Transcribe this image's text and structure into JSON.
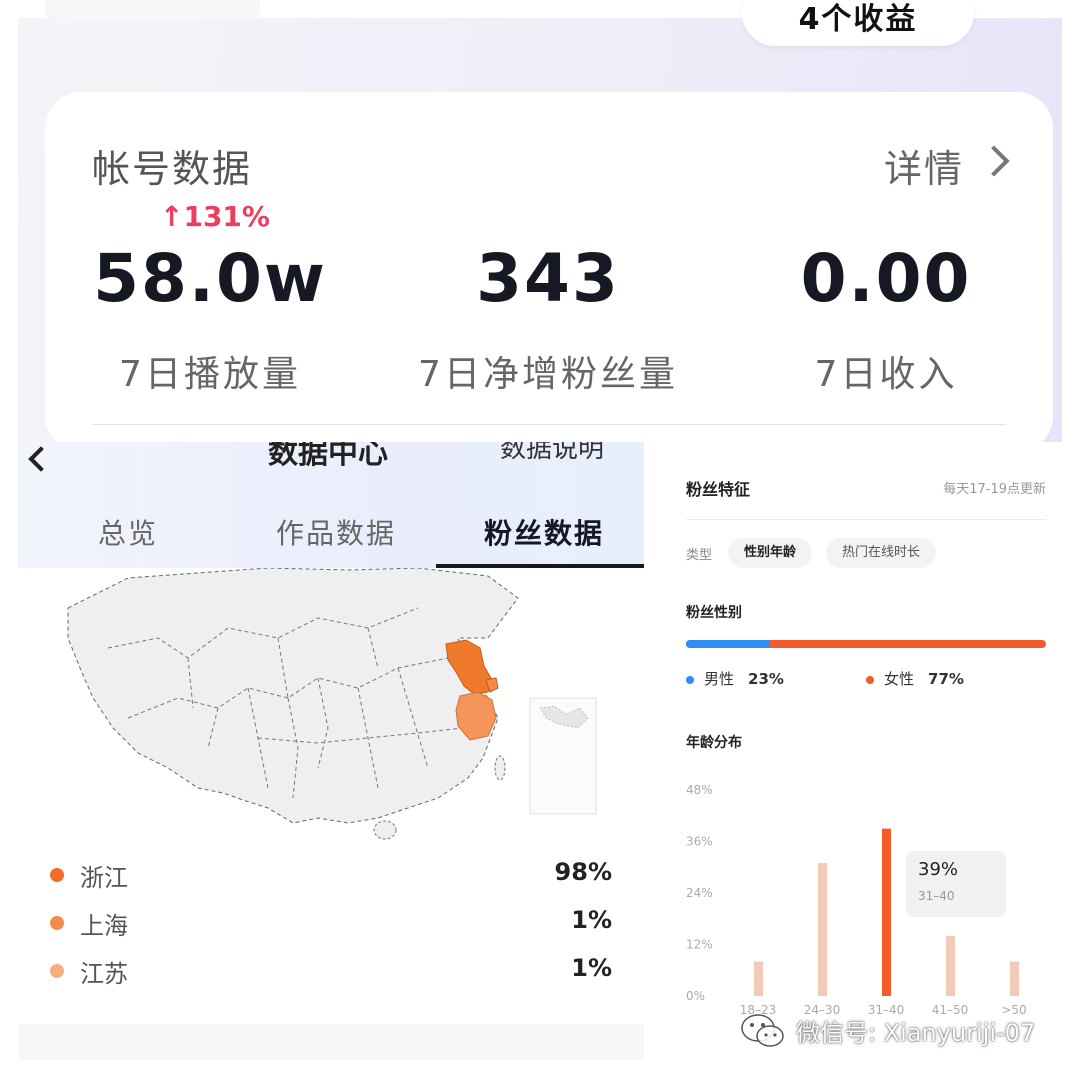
{
  "top": {
    "earnings_pill": "4个收益",
    "card_title": "帐号数据",
    "detail_label": "详情",
    "growth": "↑131%",
    "metrics": [
      {
        "value": "58.0w",
        "label": "7日播放量"
      },
      {
        "value": "343",
        "label": "7日净增粉丝量"
      },
      {
        "value": "0.00",
        "label": "7日收入"
      }
    ]
  },
  "data_center": {
    "header_cut_title": "数据中心",
    "header_cut_right": "数据说明",
    "tabs": [
      {
        "label": "总览",
        "active": false
      },
      {
        "label": "作品数据",
        "active": false
      },
      {
        "label": "粉丝数据",
        "active": true
      }
    ],
    "regions": [
      {
        "name": "浙江",
        "percent": "98%",
        "color": "#f26c2a"
      },
      {
        "name": "上海",
        "percent": "1%",
        "color": "#f58a4a"
      },
      {
        "name": "江苏",
        "percent": "1%",
        "color": "#f8ad80"
      }
    ]
  },
  "fans": {
    "title": "粉丝特征",
    "update_note": "每天17-19点更新",
    "type_label": "类型",
    "chips": [
      {
        "label": "性别年龄",
        "active": true
      },
      {
        "label": "热门在线时长",
        "active": false
      }
    ],
    "gender_title": "粉丝性别",
    "male_label": "男性",
    "male_pct": "23%",
    "male_fraction": 0.23,
    "female_label": "女性",
    "female_pct": "77%",
    "male_color": "#2f8ef4",
    "female_color": "#f25a2a",
    "age_title": "年龄分布",
    "tooltip_value": "39%",
    "tooltip_category": "31–40"
  },
  "chart_data": {
    "type": "bar",
    "title": "年龄分布",
    "categories": [
      "18–23",
      "24–30",
      "31–40",
      "41–50",
      ">50"
    ],
    "values": [
      8,
      31,
      39,
      14,
      8
    ],
    "ytick_labels": [
      "0%",
      "12%",
      "24%",
      "36%",
      "48%"
    ],
    "ylim": [
      0,
      48
    ],
    "highlight_index": 2,
    "bar_color": "#f5c9b8",
    "highlight_color": "#f25a2a"
  },
  "watermark": {
    "text": "微信号: Xianyuriji-07"
  }
}
